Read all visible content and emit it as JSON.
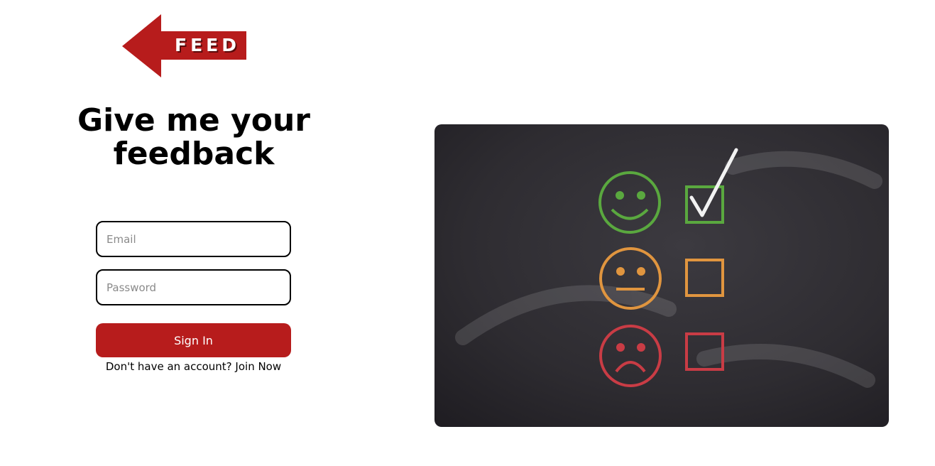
{
  "logo": {
    "text": "FEED",
    "icon": "left-arrow-icon",
    "color": "#b71c1c"
  },
  "heading": {
    "title": "Give me your feedback"
  },
  "form": {
    "email_placeholder": "Email",
    "password_placeholder": "Password",
    "signin_label": "Sign In",
    "join_prompt": "Don't have an account?",
    "join_link": "Join Now",
    "button_color": "#b71c1c"
  },
  "illustration": {
    "description_icons": [
      "smiley-face-icon",
      "neutral-face-icon",
      "sad-face-icon",
      "checkbox-icon",
      "checkmark-icon"
    ],
    "colors": {
      "happy": "#5aa83f",
      "neutral": "#e0953f",
      "sad": "#c93c45",
      "board": "#2e2b30"
    }
  }
}
